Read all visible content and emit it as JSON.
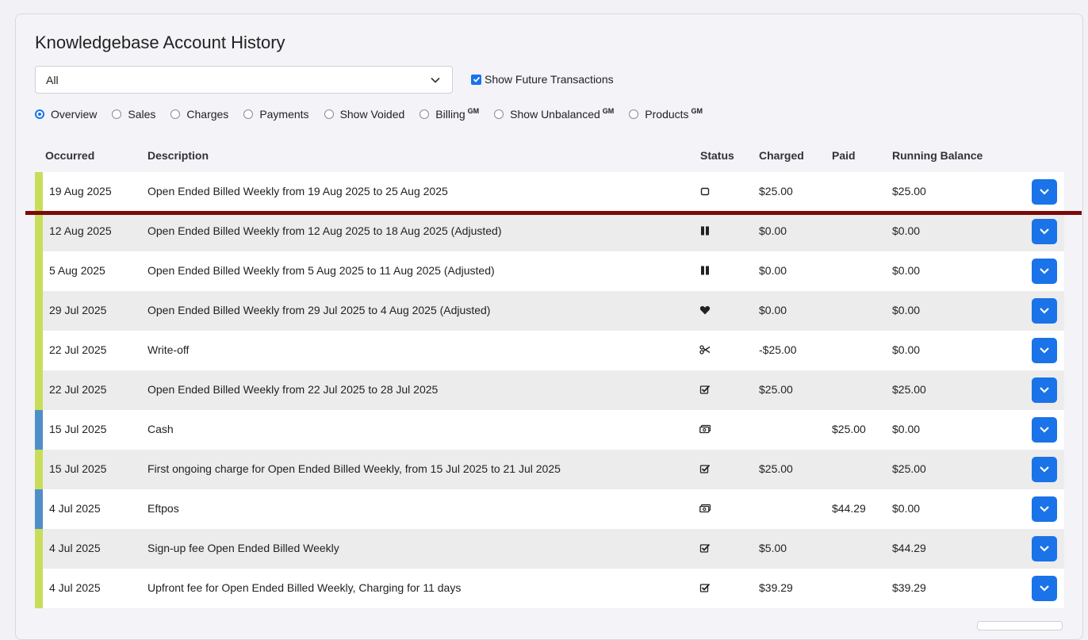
{
  "page": {
    "title": "Knowledgebase Account History"
  },
  "filter": {
    "selected": "All"
  },
  "future": {
    "label": "Show Future Transactions",
    "checked": true
  },
  "radios": [
    {
      "label": "Overview",
      "gm": "",
      "checked": true
    },
    {
      "label": "Sales",
      "gm": "",
      "checked": false
    },
    {
      "label": "Charges",
      "gm": "",
      "checked": false
    },
    {
      "label": "Payments",
      "gm": "",
      "checked": false
    },
    {
      "label": "Show Voided",
      "gm": "",
      "checked": false
    },
    {
      "label": "Billing",
      "gm": "GM",
      "checked": false
    },
    {
      "label": "Show Unbalanced",
      "gm": "GM",
      "checked": false
    },
    {
      "label": "Products",
      "gm": "GM",
      "checked": false
    }
  ],
  "table": {
    "headers": {
      "occurred": "Occurred",
      "description": "Description",
      "status": "Status",
      "charged": "Charged",
      "paid": "Paid",
      "balance": "Running Balance"
    },
    "colors": {
      "charge": "#c9dd5a",
      "payment": "#4f8fc8"
    },
    "rows": [
      {
        "occurred": "19 Aug 2025",
        "description": "Open Ended Billed Weekly from 19 Aug 2025 to 25 Aug 2025",
        "status": "square-outline-icon",
        "charged": "$25.00",
        "paid": "",
        "balance": "$25.00",
        "kind": "charge"
      },
      {
        "occurred": "12 Aug 2025",
        "description": "Open Ended Billed Weekly from 12 Aug 2025 to 18 Aug 2025 (Adjusted)",
        "status": "pause-icon",
        "charged": "$0.00",
        "paid": "",
        "balance": "$0.00",
        "kind": "charge"
      },
      {
        "occurred": "5 Aug 2025",
        "description": "Open Ended Billed Weekly from 5 Aug 2025 to 11 Aug 2025 (Adjusted)",
        "status": "pause-icon",
        "charged": "$0.00",
        "paid": "",
        "balance": "$0.00",
        "kind": "charge"
      },
      {
        "occurred": "29 Jul 2025",
        "description": "Open Ended Billed Weekly from 29 Jul 2025 to 4 Aug 2025 (Adjusted)",
        "status": "heart-icon",
        "charged": "$0.00",
        "paid": "",
        "balance": "$0.00",
        "kind": "charge"
      },
      {
        "occurred": "22 Jul 2025",
        "description": "Write-off",
        "status": "scissors-icon",
        "charged": "-$25.00",
        "paid": "",
        "balance": "$0.00",
        "kind": "charge"
      },
      {
        "occurred": "22 Jul 2025",
        "description": "Open Ended Billed Weekly from 22 Jul 2025 to 28 Jul 2025",
        "status": "checkbox-icon",
        "charged": "$25.00",
        "paid": "",
        "balance": "$25.00",
        "kind": "charge"
      },
      {
        "occurred": "15 Jul 2025",
        "description": "Cash",
        "status": "money-icon",
        "charged": "",
        "paid": "$25.00",
        "balance": "$0.00",
        "kind": "payment"
      },
      {
        "occurred": "15 Jul 2025",
        "description": "First ongoing charge for Open Ended Billed Weekly, from 15 Jul 2025 to 21 Jul 2025",
        "status": "checkbox-icon",
        "charged": "$25.00",
        "paid": "",
        "balance": "$25.00",
        "kind": "charge"
      },
      {
        "occurred": "4 Jul 2025",
        "description": "Eftpos",
        "status": "money-icon",
        "charged": "",
        "paid": "$44.29",
        "balance": "$0.00",
        "kind": "payment"
      },
      {
        "occurred": "4 Jul 2025",
        "description": "Sign-up fee Open Ended Billed Weekly",
        "status": "checkbox-icon",
        "charged": "$5.00",
        "paid": "",
        "balance": "$44.29",
        "kind": "charge"
      },
      {
        "occurred": "4 Jul 2025",
        "description": "Upfront fee for Open Ended Billed Weekly, Charging for 11 days",
        "status": "checkbox-icon",
        "charged": "$39.29",
        "paid": "",
        "balance": "$39.29",
        "kind": "charge"
      }
    ]
  }
}
